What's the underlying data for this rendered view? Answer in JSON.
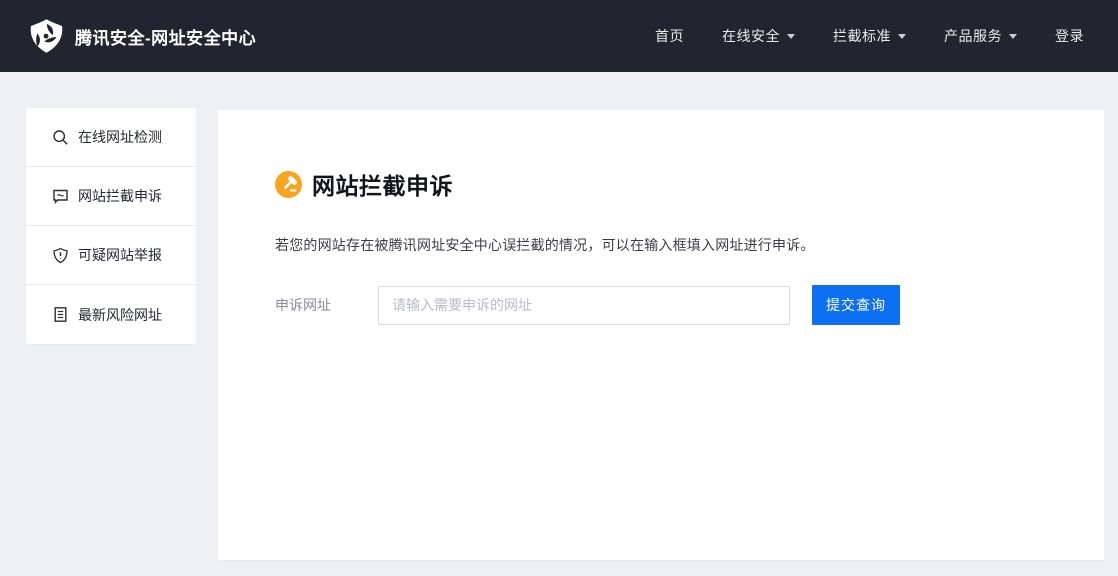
{
  "header": {
    "brand": "腾讯安全-网址安全中心",
    "nav": [
      {
        "label": "首页",
        "has_dropdown": false
      },
      {
        "label": "在线安全",
        "has_dropdown": true
      },
      {
        "label": "拦截标准",
        "has_dropdown": true
      },
      {
        "label": "产品服务",
        "has_dropdown": true
      },
      {
        "label": "登录",
        "has_dropdown": false
      }
    ]
  },
  "sidebar": {
    "items": [
      {
        "label": "在线网址检测",
        "icon": "search-icon"
      },
      {
        "label": "网站拦截申诉",
        "icon": "comment-icon"
      },
      {
        "label": "可疑网站举报",
        "icon": "shield-alert-icon"
      },
      {
        "label": "最新风险网址",
        "icon": "document-icon"
      }
    ]
  },
  "main": {
    "title": "网站拦截申诉",
    "description": "若您的网站存在被腾讯网址安全中心误拦截的情况，可以在输入框填入网址进行申诉。",
    "form": {
      "label": "申诉网址",
      "placeholder": "请输入需要申诉的网址",
      "submit_label": "提交查询"
    }
  },
  "colors": {
    "header_bg": "#22252f",
    "page_bg": "#eef0f4",
    "accent_blue": "#0d6ff2",
    "badge_gold": "#f7a41f"
  }
}
